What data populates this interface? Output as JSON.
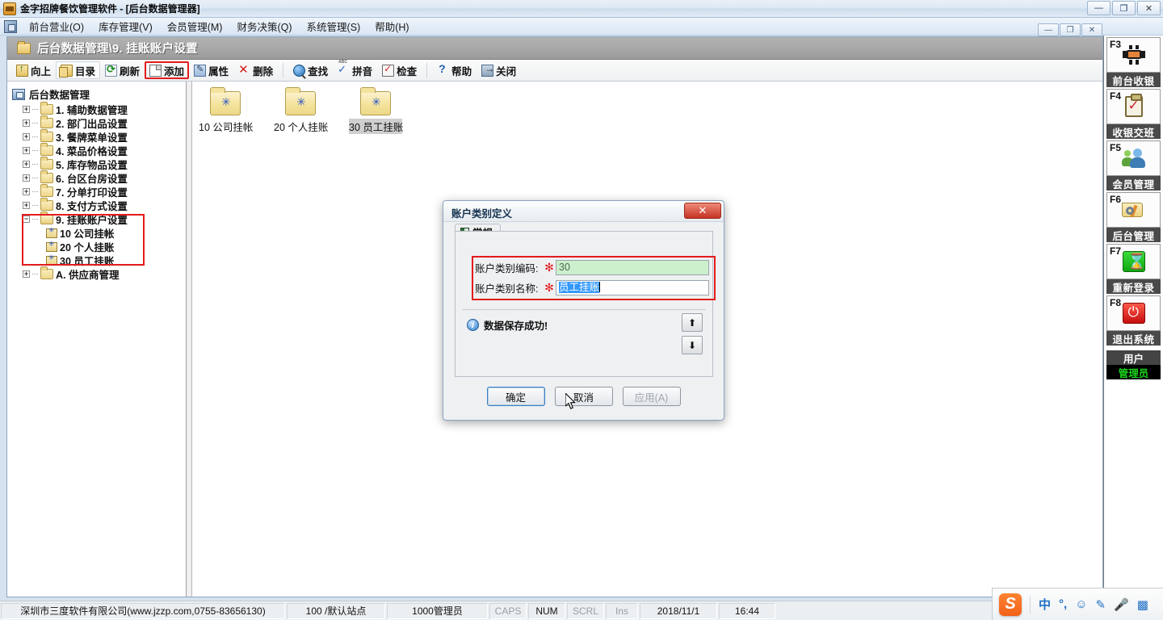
{
  "window": {
    "title": "金字招牌餐饮管理软件 - [后台数据管理器]",
    "minimize": "—",
    "maximize": "❐",
    "close": "✕"
  },
  "mdi": {
    "minimize": "—",
    "restore": "❐",
    "close": "✕"
  },
  "menubar": {
    "items": [
      {
        "label": "前台营业(O)"
      },
      {
        "label": "库存管理(V)"
      },
      {
        "label": "会员管理(M)"
      },
      {
        "label": "财务决策(Q)"
      },
      {
        "label": "系统管理(S)"
      },
      {
        "label": "帮助(H)"
      }
    ]
  },
  "breadcrumb": {
    "text": "后台数据管理\\9. 挂账账户设置"
  },
  "toolbar": {
    "buttons": [
      {
        "label": "向上",
        "icon": "up-folder-icon"
      },
      {
        "label": "目录",
        "icon": "directory-icon"
      },
      {
        "label": "刷新",
        "icon": "refresh-icon"
      },
      {
        "label": "添加",
        "icon": "add-document-icon"
      },
      {
        "label": "属性",
        "icon": "properties-icon"
      },
      {
        "label": "删除",
        "icon": "delete-icon"
      },
      {
        "label": "查找",
        "icon": "search-icon"
      },
      {
        "label": "拼音",
        "icon": "pinyin-icon"
      },
      {
        "label": "检查",
        "icon": "check-icon"
      },
      {
        "label": "帮助",
        "icon": "help-icon"
      },
      {
        "label": "关闭",
        "icon": "exit-icon"
      }
    ],
    "highlight_color": "#e41b1b"
  },
  "tree": {
    "root": "后台数据管理",
    "nodes": [
      {
        "label": "1. 辅助数据管理",
        "expander": "+"
      },
      {
        "label": "2. 部门出品设置",
        "expander": "+"
      },
      {
        "label": "3. 餐牌菜单设置",
        "expander": "+"
      },
      {
        "label": "4. 菜品价格设置",
        "expander": "+"
      },
      {
        "label": "5. 库存物品设置",
        "expander": "+"
      },
      {
        "label": "6. 台区台房设置",
        "expander": "+"
      },
      {
        "label": "7. 分单打印设置",
        "expander": "+"
      },
      {
        "label": "8. 支付方式设置",
        "expander": "+"
      },
      {
        "label": "9. 挂账账户设置",
        "expander": "−"
      }
    ],
    "children": [
      {
        "label": "10 公司挂帐"
      },
      {
        "label": "20 个人挂账"
      },
      {
        "label": "30 员工挂账"
      }
    ],
    "last_node": {
      "label": "A. 供应商管理",
      "expander": "+"
    }
  },
  "content": {
    "items": [
      {
        "label": "10 公司挂帐",
        "selected": false
      },
      {
        "label": "20 个人挂账",
        "selected": false
      },
      {
        "label": "30 员工挂账",
        "selected": true
      }
    ]
  },
  "dialog": {
    "title": "账户类别定义",
    "close": "✕",
    "tab": "常规",
    "required_mark": "✻",
    "fields": [
      {
        "label": "账户类别编码:",
        "value": "30",
        "style": "green"
      },
      {
        "label": "账户类别名称:",
        "value": "员工挂账",
        "style": "selected"
      }
    ],
    "message": "数据保存成功!",
    "spinner_up": "⬆",
    "spinner_down": "⬇",
    "buttons": [
      {
        "label": "确定",
        "state": "default"
      },
      {
        "label": "取消",
        "state": "normal"
      },
      {
        "label": "应用(A)",
        "state": "disabled"
      }
    ]
  },
  "rail": {
    "groups": [
      {
        "key": "F3",
        "icon": "restaurant-table-icon",
        "label": "前台收银"
      },
      {
        "key": "F4",
        "icon": "clipboard-check-icon",
        "label": "收银交班"
      },
      {
        "key": "F5",
        "icon": "members-icon",
        "label": "会员管理"
      },
      {
        "key": "F6",
        "icon": "folder-tools-icon",
        "label": "后台管理"
      },
      {
        "key": "F7",
        "icon": "hourglass-icon",
        "label": "重新登录"
      },
      {
        "key": "F8",
        "icon": "power-icon",
        "label": "退出系统"
      }
    ],
    "user_caption": "用户",
    "user_value": "管理员",
    "user_value_color": "#19d419"
  },
  "statusbar": {
    "company": "深圳市三度软件有限公司(www.jzzp.com,0755-83656130)",
    "station": "100 /默认站点",
    "operator": "1000管理员",
    "caps": "CAPS",
    "num": "NUM",
    "scrl": "SCRL",
    "ins": "Ins",
    "date": "2018/11/1",
    "time": "16:44"
  },
  "ime": {
    "logo": "S",
    "mode": "中",
    "punctuation": "°,",
    "emoji": "☺",
    "pen": "✎",
    "mic": "🎤",
    "grid": "▩"
  }
}
